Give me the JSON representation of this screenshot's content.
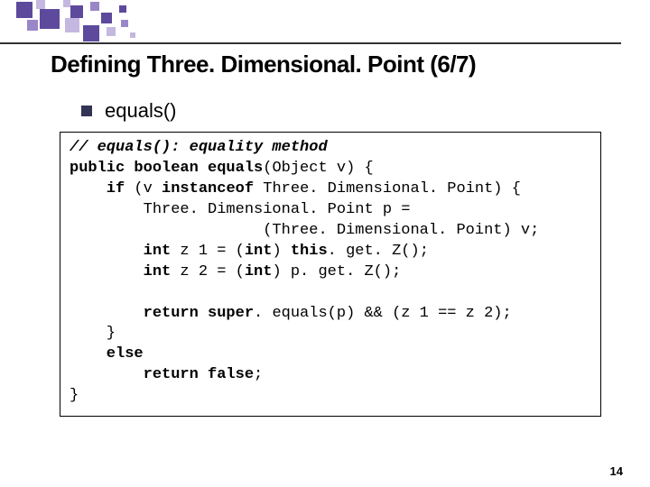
{
  "slide": {
    "title": "Defining Three. Dimensional. Point (6/7)",
    "bullet": "equals()",
    "number": "14"
  },
  "code": {
    "c1": "// equals(): equality method",
    "c2a": "public boolean equals",
    "c2b": "(Object v) {",
    "c3a": "    if",
    "c3b": " (v ",
    "c3c": "instanceof",
    "c3d": " Three. Dimensional. Point) {",
    "c4": "        Three. Dimensional. Point p =",
    "c5": "                     (Three. Dimensional. Point) v;",
    "c6a": "        int",
    "c6b": " z 1 = (",
    "c6c": "int",
    "c6d": ") ",
    "c6e": "this",
    "c6f": ". get. Z();",
    "c7a": "        int",
    "c7b": " z 2 = (",
    "c7c": "int",
    "c7d": ") p. get. Z();",
    "c8": " ",
    "c9a": "        return super",
    "c9b": ". equals(p) && (z 1 == z 2);",
    "c10": "    }",
    "c11a": "    else",
    "c12a": "        return false",
    "c12b": ";",
    "c13": "}"
  }
}
